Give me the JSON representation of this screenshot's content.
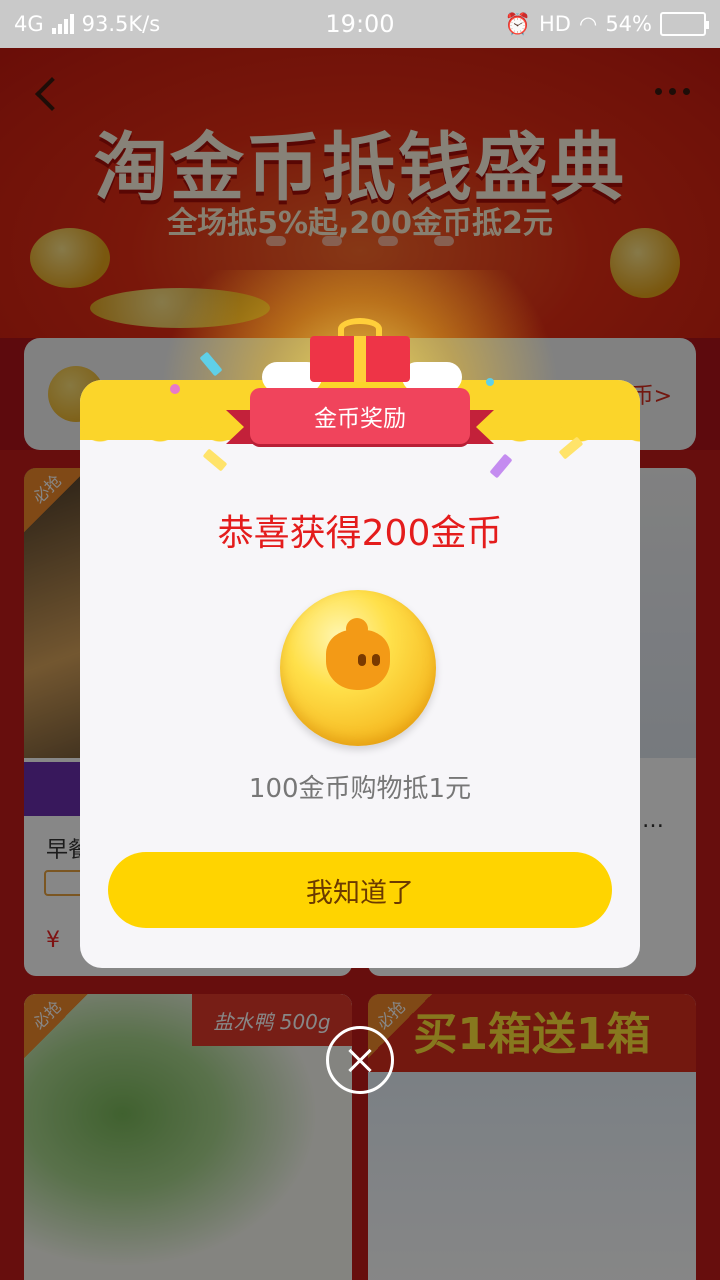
{
  "status_bar": {
    "network": "4G",
    "speed": "93.5K/s",
    "time": "19:00",
    "hd": "HD",
    "battery": "54%",
    "battery_level": 0.54
  },
  "banner": {
    "title": "淘金币抵钱盛典",
    "subtitle": "全场抵5%起,200金币抵2元"
  },
  "info_bar": {
    "link_suffix": "币>"
  },
  "modal": {
    "ribbon_label": "金币奖励",
    "heading": "恭喜获得200金币",
    "subtext": "100金币购物抵1元",
    "confirm_label": "我知道了"
  },
  "cards": {
    "badge_label": "必抢",
    "c1_title": "早餐",
    "c1_price": "¥",
    "c2_ellipsis": "…",
    "c3_tag": "盐水鸭 500g",
    "c4_headline": "买1箱送1箱"
  },
  "colors": {
    "modal_accent": "#fbd52a",
    "heading_red": "#e41c1c",
    "button_yellow": "#ffd400",
    "ribbon_pink": "#f0445c"
  }
}
